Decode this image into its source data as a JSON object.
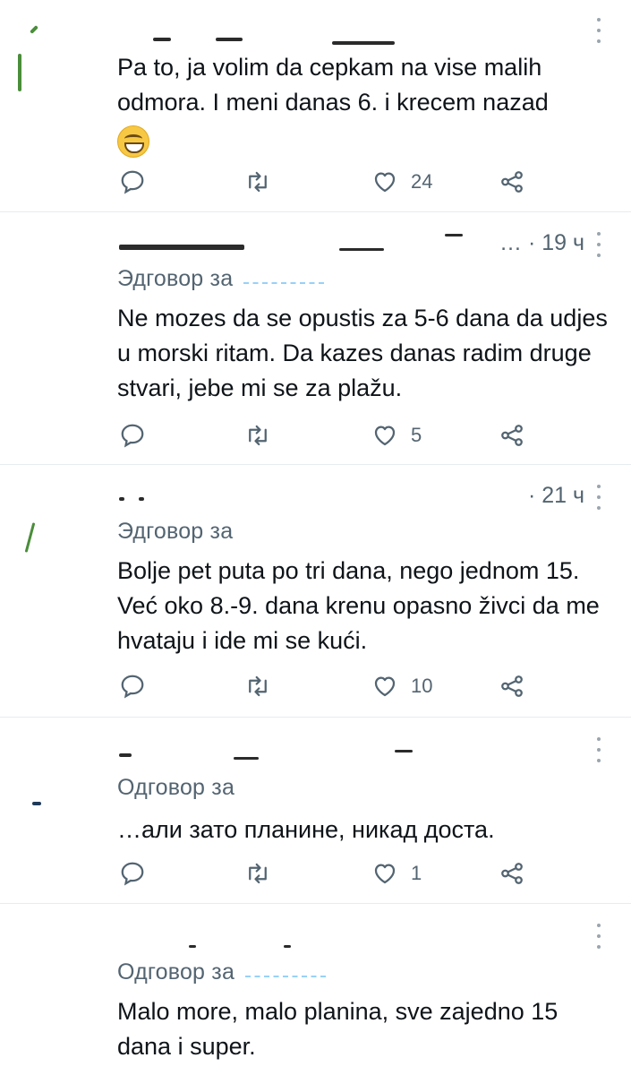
{
  "tweets": [
    {
      "time": "",
      "reply_prefix": "",
      "text": "Pa to, ja volim da cepkam na vise malih odmora. I meni danas 6. i krecem nazad",
      "emoji": "grinning-face-with-smiling-eyes",
      "actions": {
        "reply": "",
        "retweet": "",
        "like": "24",
        "share": ""
      }
    },
    {
      "time": "… · 19 ч",
      "reply_prefix": "Эдговор за",
      "text": "Ne mozes da se opustis za 5-6 dana  da udjes u morski ritam. Da kazes danas radim druge stvari, jebe mi se za plažu.",
      "actions": {
        "reply": "",
        "retweet": "",
        "like": "5",
        "share": ""
      }
    },
    {
      "time": "· 21 ч",
      "reply_prefix": "Эдговор за",
      "text": "Bolje pet puta po tri dana, nego jednom 15. Već oko 8.-9. dana krenu opasno živci da me hvataju i ide mi se kući.",
      "actions": {
        "reply": "",
        "retweet": "",
        "like": "10",
        "share": ""
      }
    },
    {
      "time": "",
      "reply_prefix": "Одговор за",
      "text": "…али зато планине, никад доста.",
      "actions": {
        "reply": "",
        "retweet": "",
        "like": "1",
        "share": ""
      }
    },
    {
      "time": "",
      "reply_prefix": "Одговор за",
      "text": "Malo more, malo planina, sve zajedno 15 dana i super.",
      "actions": {
        "reply": "",
        "retweet": "",
        "like": "",
        "share": ""
      }
    }
  ],
  "colors": {
    "text": "#0f1419",
    "muted": "#536471",
    "divider": "#e6ecf0"
  },
  "icons": [
    "reply-icon",
    "retweet-icon",
    "like-icon",
    "share-icon",
    "more-icon"
  ]
}
